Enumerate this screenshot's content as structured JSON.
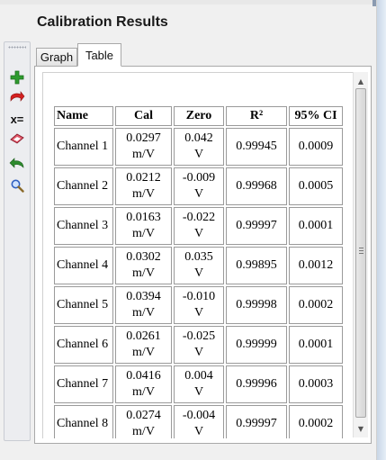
{
  "title": "Calibration Results",
  "tabs": [
    {
      "label": "Graph",
      "active": false
    },
    {
      "label": "Table",
      "active": true
    }
  ],
  "toolbar": {
    "tools": [
      {
        "name": "add-icon",
        "color": "#2e9b2e"
      },
      {
        "name": "remove-icon",
        "color": "#d42020"
      },
      {
        "name": "equation-icon",
        "label": "x="
      },
      {
        "name": "eraser-icon",
        "color": "#c8324a"
      },
      {
        "name": "undo-icon",
        "color": "#2e8b2e"
      },
      {
        "name": "zoom-icon",
        "color": "#3060c0"
      }
    ]
  },
  "table": {
    "headers": [
      "Name",
      "Cal",
      "Zero",
      "R²",
      "95% CI"
    ],
    "rows": [
      {
        "name": "Channel 1",
        "cal": "0.0297",
        "cal_unit": "m/V",
        "zero": "0.042",
        "zero_unit": "V",
        "r2": "0.99945",
        "ci": "0.0009"
      },
      {
        "name": "Channel 2",
        "cal": "0.0212",
        "cal_unit": "m/V",
        "zero": "-0.009",
        "zero_unit": "V",
        "r2": "0.99968",
        "ci": "0.0005"
      },
      {
        "name": "Channel 3",
        "cal": "0.0163",
        "cal_unit": "m/V",
        "zero": "-0.022",
        "zero_unit": "V",
        "r2": "0.99997",
        "ci": "0.0001"
      },
      {
        "name": "Channel 4",
        "cal": "0.0302",
        "cal_unit": "m/V",
        "zero": "0.035",
        "zero_unit": "V",
        "r2": "0.99895",
        "ci": "0.0012"
      },
      {
        "name": "Channel 5",
        "cal": "0.0394",
        "cal_unit": "m/V",
        "zero": "-0.010",
        "zero_unit": "V",
        "r2": "0.99998",
        "ci": "0.0002"
      },
      {
        "name": "Channel 6",
        "cal": "0.0261",
        "cal_unit": "m/V",
        "zero": "-0.025",
        "zero_unit": "V",
        "r2": "0.99999",
        "ci": "0.0001"
      },
      {
        "name": "Channel 7",
        "cal": "0.0416",
        "cal_unit": "m/V",
        "zero": "0.004",
        "zero_unit": "V",
        "r2": "0.99996",
        "ci": "0.0003"
      },
      {
        "name": "Channel 8",
        "cal": "0.0274",
        "cal_unit": "m/V",
        "zero": "-0.004",
        "zero_unit": "V",
        "r2": "0.99997",
        "ci": "0.0002"
      }
    ]
  },
  "scrollbar": {
    "up_arrow": "▲",
    "down_arrow": "▼"
  }
}
